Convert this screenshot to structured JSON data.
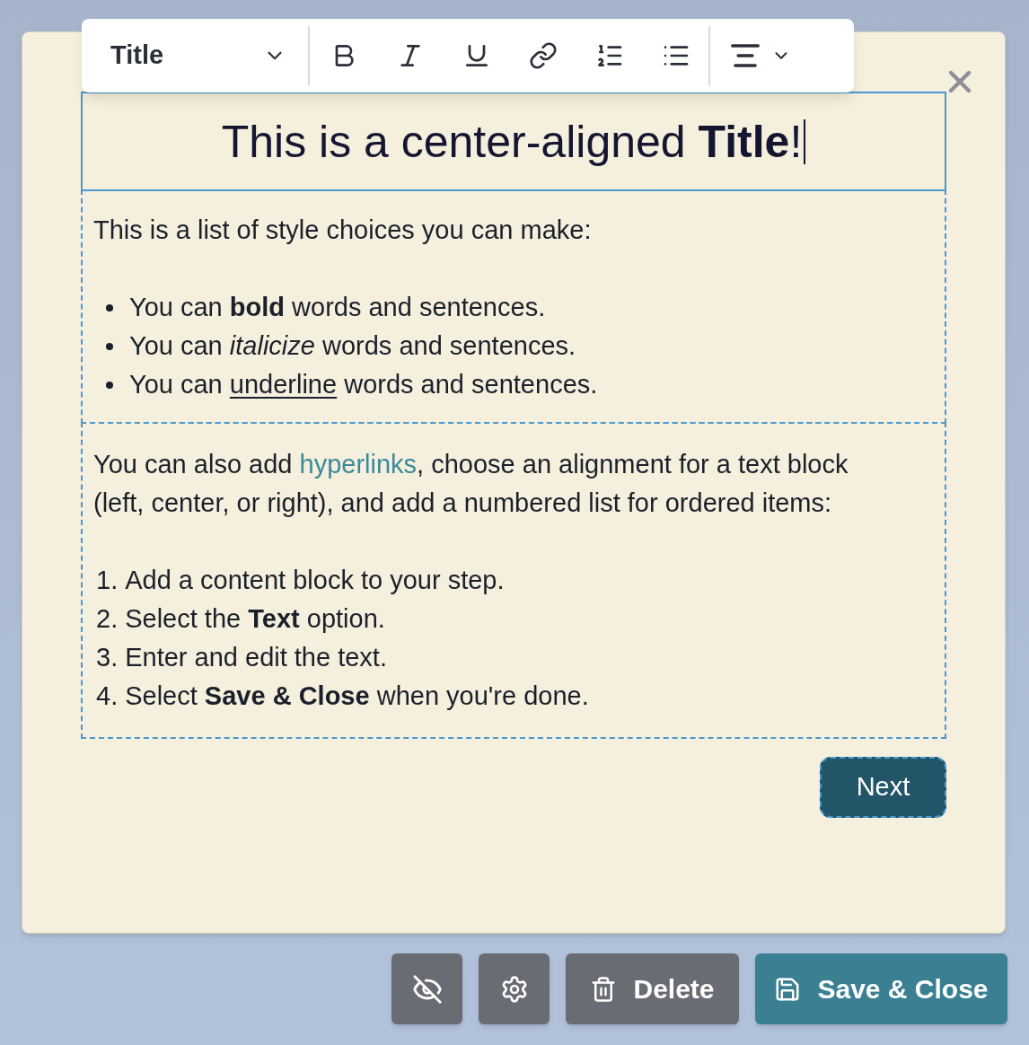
{
  "toolbar": {
    "block_style": "Title",
    "tools": [
      {
        "kind": "bold"
      },
      {
        "kind": "italic"
      },
      {
        "kind": "underline"
      },
      {
        "kind": "link"
      },
      {
        "kind": "numbered-list"
      },
      {
        "kind": "bullet-list"
      },
      {
        "kind": "align"
      }
    ]
  },
  "title_block": {
    "text": "This is a center-aligned **Title**!"
  },
  "blocks": [
    {
      "kind": "bullet",
      "intro": [
        {
          "text": "This is a list of style choices you can make:"
        }
      ],
      "items": [
        {
          "parts": [
            {
              "text": "You can "
            },
            {
              "kind": "bold",
              "text": "bold"
            },
            {
              "text": " words and sentences."
            }
          ]
        },
        {
          "parts": [
            {
              "text": "You can "
            },
            {
              "kind": "italic",
              "text": "italicize"
            },
            {
              "text": " words and sentences."
            }
          ]
        },
        {
          "parts": [
            {
              "text": "You can "
            },
            {
              "kind": "underline",
              "text": "underline"
            },
            {
              "text": " words and sentences."
            }
          ]
        }
      ]
    },
    {
      "kind": "numbered",
      "intro": [
        {
          "text": "You can also add "
        },
        {
          "kind": "link",
          "text": "hyperlinks"
        },
        {
          "text": ", choose an alignment for a text block (left, center, or right), and add a numbered list for ordered items:"
        }
      ],
      "items": [
        {
          "number": "1.",
          "parts": [
            {
              "text": "Add a content block to your step."
            }
          ]
        },
        {
          "number": "2.",
          "parts": [
            {
              "text": "Select the "
            },
            {
              "kind": "bold",
              "text": "Text"
            },
            {
              "text": " option."
            }
          ]
        },
        {
          "number": "3.",
          "parts": [
            {
              "text": "Enter and edit the text."
            }
          ]
        },
        {
          "number": "4.",
          "parts": [
            {
              "text": "Select "
            },
            {
              "kind": "bold",
              "text": "Save & Close"
            },
            {
              "text": " when you're done."
            }
          ]
        }
      ]
    }
  ],
  "next_button": "Next",
  "actions": [
    {
      "kind": "hide"
    },
    {
      "kind": "settings"
    },
    {
      "kind": "delete",
      "label": "Delete"
    },
    {
      "kind": "save",
      "label": "Save & Close"
    }
  ]
}
